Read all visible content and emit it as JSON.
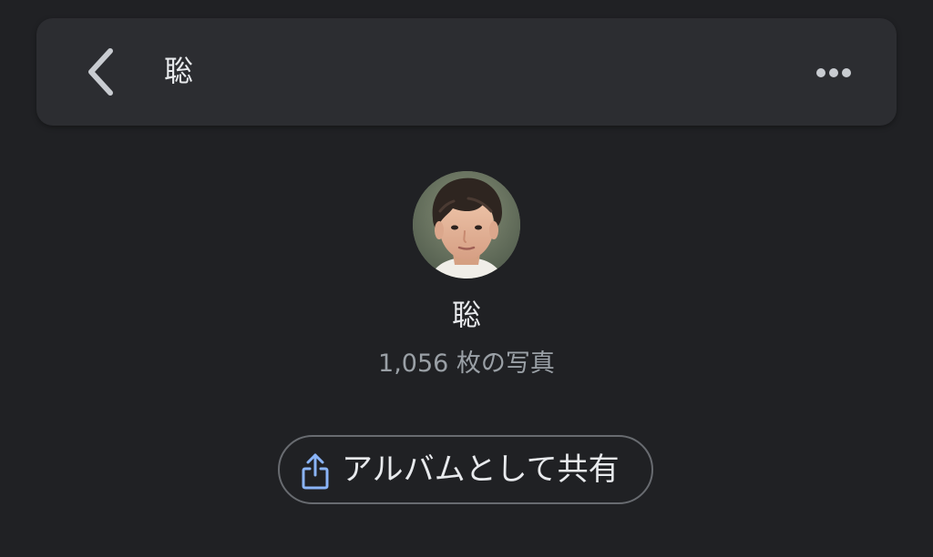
{
  "top_bar": {
    "title": "聡",
    "back_icon": "chevron-left-icon",
    "more_icon": "more-horizontal-icon"
  },
  "profile": {
    "name": "聡",
    "photo_count": "1,056 枚の写真",
    "avatar": "person-face-photo"
  },
  "actions": {
    "share_album_label": "アルバムとして共有",
    "share_icon": "share-icon"
  },
  "colors": {
    "background": "#202124",
    "top_bar": "#2c2d31",
    "primary_text": "#e8eaed",
    "secondary_text": "#9aa0a6",
    "accent": "#8ab4f8",
    "button_border": "#686b70"
  }
}
